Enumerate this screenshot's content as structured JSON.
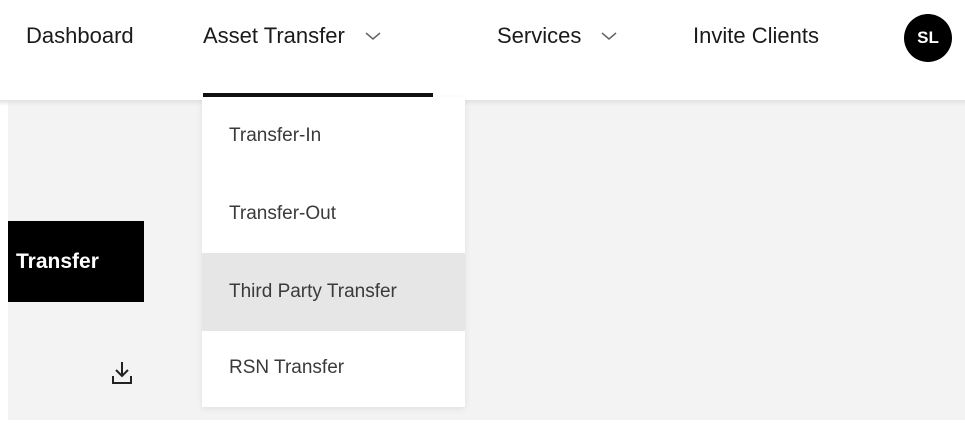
{
  "nav": {
    "dashboard": "Dashboard",
    "asset_transfer": "Asset Transfer",
    "services": "Services",
    "invite_clients": "Invite Clients",
    "avatar_initials": "SL"
  },
  "dropdown": {
    "items": [
      {
        "label": "Transfer-In"
      },
      {
        "label": "Transfer-Out"
      },
      {
        "label": "Third Party Transfer",
        "highlighted": true
      },
      {
        "label": "RSN Transfer"
      }
    ]
  },
  "content": {
    "transfer_button_label": "Transfer",
    "download_icon": "download-icon"
  },
  "colors": {
    "text": "#1a1a1a",
    "active_underline": "#111111",
    "content_bg": "#f3f3f3",
    "menu_hover": "#e6e6e6",
    "button_bg": "#000000"
  }
}
